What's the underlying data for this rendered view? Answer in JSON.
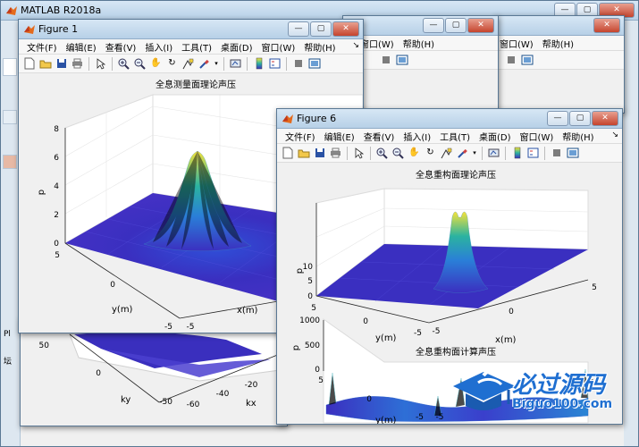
{
  "main_window": {
    "title": "MATLAB R2018a",
    "left_fragments": [
      "Pl",
      "坛"
    ]
  },
  "menu_labels": [
    "文件(F)",
    "编辑(E)",
    "查看(V)",
    "插入(I)",
    "工具(T)",
    "桌面(D)",
    "窗口(W)",
    "帮助(H)"
  ],
  "back_menus": {
    "m1": [
      "窗口(W)",
      "帮助(H)"
    ],
    "m2": [
      "窗口(W)",
      "帮助(H)"
    ]
  },
  "window_controls": {
    "minimize": "—",
    "maximize": "▢",
    "close": "✕"
  },
  "toolbar_icons": [
    "new-figure-icon",
    "open-file-icon",
    "save-icon",
    "print-icon",
    "select-arrow-icon",
    "zoom-in-icon",
    "zoom-out-icon",
    "pan-hand-icon",
    "rotate-3d-icon",
    "data-cursor-icon",
    "brush-icon",
    "link-plot-icon",
    "colorbar-icon",
    "legend-icon",
    "hide-plot-tools-icon",
    "show-plot-tools-icon"
  ],
  "figure1": {
    "title": "Figure 1",
    "plot_title": "全息测量面理论声压",
    "zlabel": "p",
    "ylabel": "y(m)",
    "xlabel": "x(m)",
    "z_ticks": [
      "0",
      "2",
      "4",
      "6",
      "8"
    ],
    "y_ticks": [
      "5",
      "0",
      "-5"
    ],
    "x_ticks": [
      "-5"
    ]
  },
  "figure6": {
    "title": "Figure 6",
    "plot1": {
      "title": "全息重构面理论声压",
      "zlabel": "p",
      "ylabel": "y(m)",
      "xlabel": "x(m)",
      "z_ticks": [
        "0",
        "5",
        "10"
      ],
      "y_ticks": [
        "5",
        "0",
        "-5"
      ],
      "x_ticks": [
        "-5",
        "0",
        "5"
      ]
    },
    "plot2": {
      "title": "全息重构面计算声压",
      "zlabel": "p",
      "ylabel": "y(m)",
      "z_ticks": [
        "0",
        "500",
        "1000"
      ],
      "y_ticks": [
        "5",
        "0",
        "-5"
      ],
      "x_ticks": [
        "-5",
        "0",
        "5"
      ]
    }
  },
  "background_plot": {
    "ylabel": "ky",
    "xlabel": "kx",
    "y_ticks": [
      "50",
      "0",
      "-50"
    ],
    "x_ticks": [
      "-60",
      "-40",
      "-20"
    ]
  },
  "watermark": {
    "name": "必过源码",
    "url": "Biguo100.com"
  },
  "colors": {
    "surface_low": "#3b2fc0",
    "surface_high": "#f4e23a",
    "title_bar": "#c6dbef",
    "desktop": "#6f9ab6"
  }
}
